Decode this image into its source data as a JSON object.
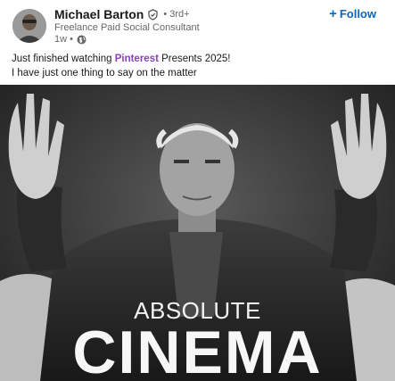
{
  "author": {
    "name": "Michael Barton",
    "degree": "• 3rd+",
    "headline": "Freelance Paid Social Consultant",
    "time": "1w •"
  },
  "actions": {
    "follow_label": "Follow",
    "follow_symbol": "+"
  },
  "post": {
    "line1_before": "Just finished watching ",
    "line1_hashtag": "Pinterest",
    "line1_after": " Presents 2025!",
    "line2": "I have just one thing to say on the matter"
  },
  "media": {
    "caption_top": "ABSOLUTE",
    "caption_bottom": "CINEMA"
  },
  "icons": {
    "verified": "verified-shield-icon",
    "globe": "globe-icon"
  },
  "colors": {
    "accent": "#0a66c2",
    "hashtag": "#8a3fbf"
  }
}
